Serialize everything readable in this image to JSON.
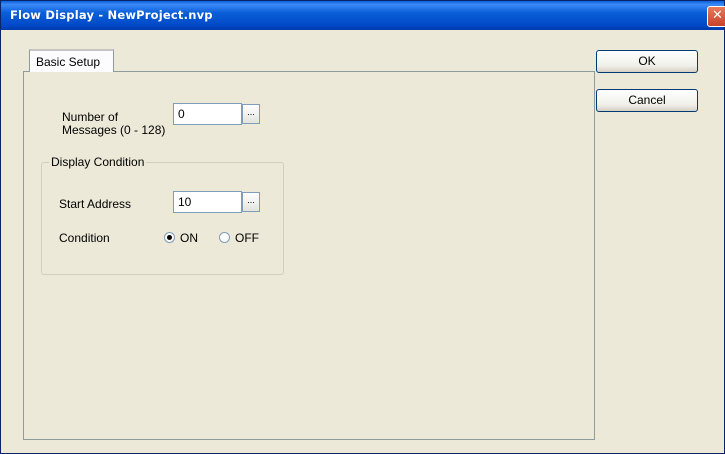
{
  "window": {
    "title": "Flow Display - NewProject.nvp",
    "close_glyph": "✕"
  },
  "tabs": [
    {
      "label": "Basic Setup"
    }
  ],
  "buttons": {
    "ok": "OK",
    "cancel": "Cancel"
  },
  "messages": {
    "label_line1": "Number of",
    "label_line2": "Messages (0 - 128)",
    "value": "0",
    "browse_glyph": "..."
  },
  "display_condition": {
    "legend": "Display Condition",
    "start_address_label": "Start Address",
    "start_address_value": "10",
    "browse_glyph": "...",
    "condition_label": "Condition",
    "options": [
      {
        "label": "ON",
        "selected": true
      },
      {
        "label": "OFF",
        "selected": false
      }
    ]
  }
}
